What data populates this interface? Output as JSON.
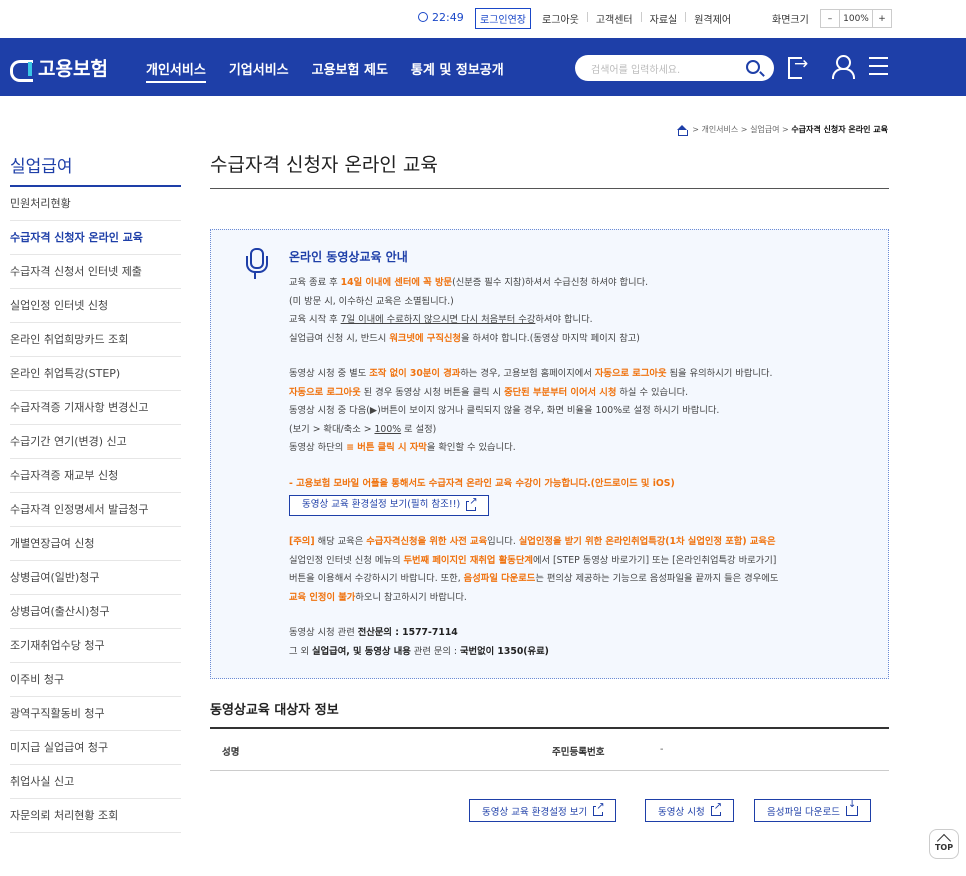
{
  "utility": {
    "time": "22:49",
    "extend_login": "로그인연장",
    "links": [
      "로그아웃",
      "고객센터",
      "자료실",
      "원격제어"
    ],
    "zoom_label": "화면크기",
    "zoom_minus": "–",
    "zoom_value": "100%",
    "zoom_plus": "+"
  },
  "header": {
    "logo": "고용보험",
    "menu": [
      "개인서비스",
      "기업서비스",
      "고용보험 제도",
      "통계 및 정보공개"
    ],
    "active_menu": "개인서비스",
    "search_placeholder": "검색어를 입력하세요."
  },
  "breadcrumb": {
    "items": [
      "개인서비스",
      "실업급여"
    ],
    "current": "수급자격 신청자 온라인 교육"
  },
  "sidebar": {
    "title": "실업급여",
    "items": [
      "민원처리현황",
      "수급자격 신청자 온라인 교육",
      "수급자격 신청서 인터넷 제출",
      "실업인정 인터넷 신청",
      "온라인 취업희망카드 조회",
      "온라인 취업특강(STEP)",
      "수급자격증 기재사항 변경신고",
      "수급기간 연기(변경) 신고",
      "수급자격증 재교부 신청",
      "수급자격 인정명세서 발급청구",
      "개별연장급여 신청",
      "상병급여(일반)청구",
      "상병급여(출산시)청구",
      "조기재취업수당 청구",
      "이주비 청구",
      "광역구직활동비 청구",
      "미지급 실업급여 청구",
      "취업사실 신고",
      "자문의뢰 처리현황 조회"
    ],
    "active_index": 1
  },
  "page": {
    "title": "수급자격 신청자 온라인 교육"
  },
  "guide": {
    "title": "온라인 동영상교육 안내",
    "p1": {
      "a1": "교육 종료 후 ",
      "a2": "14일 이내에 센터에 꼭 방문",
      "a3": "(신분증 필수 지참)하셔서 수급신청 하셔야 합니다.",
      "b": "(미 방문 시, 이수하신 교육은 소멸됩니다.)",
      "c1": "교육 시작 후 ",
      "c2": "7일 이내에 수료하지 않으시면 다시 처음부터 수강",
      "c3": "하셔야 합니다.",
      "d1": "실업급여 신청 시, 반드시 ",
      "d2": "워크넷에 구직신청",
      "d3": "을 하셔야 합니다.(동영상 마지막 페이지 참고)"
    },
    "p2": {
      "a1": "동영상 시청 중 별도 ",
      "a2": "조작 없이 30분이 경과",
      "a3": "하는 경우, 고용보험 홈페이지에서 ",
      "a4": "자동으로 로그아웃",
      "a5": " 됨을 유의하시기 바랍니다.",
      "b1": "자동으로 로그아웃",
      "b2": " 된 경우 동영상 시청 버튼을 클릭 시 ",
      "b3": "중단된 부분부터 이어서 시청",
      "b4": " 하실 수 있습니다.",
      "c": "동영상 시청 중 다음(▶)버튼이 보이지 않거나 클릭되지 않을 경우, 화면 비율을 100%로 설정 하시기 바랍니다.",
      "d1": "(보기 > 확대/축소 > ",
      "d2": "100%",
      "d3": " 로 설정)",
      "e1": "동영상 하단의 ",
      "e2": "≡ 버튼 클릭 시 자막",
      "e3": "을 확인할 수 있습니다."
    },
    "mobile_notice": "- 고용보험 모바일 어플을 통해서도 수급자격 온라인 교육 수강이 가능합니다.(안드로이드 및 iOS)",
    "env_button": "동영상 교육 환경설정 보기(필히 참조!!)",
    "p3": {
      "a1": "[주의]",
      "a2": " 해당 교육은 ",
      "a3": "수급자격신청을 위한 사전 교육",
      "a4": "입니다. ",
      "a5": "실업인정을 받기 위한 온라인취업특강(1차 실업인정 포함) 교육은",
      "b1": "실업인정 인터넷 신청 메뉴의 ",
      "b2": "두번째 페이지인 재취업 활동단계",
      "b3": "에서 [STEP 동영상 바로가기] 또는 [온라인취업특강 바로가기]",
      "c1": "버튼을 이용해서 수강하시기 바랍니다. 또한, ",
      "c2": "음성파일 다운로드",
      "c3": "는 편의상 제공하는 기능으로 음성파일을 끝까지 들은 경우에도",
      "d1": "교육 인정이 불가",
      "d2": "하오니 참고하시기 바랍니다."
    },
    "p4": {
      "a1": "동영상 시청 관련 ",
      "a2": "전산문의 : 1577-7114",
      "b1": "그 외 ",
      "b2": "실업급여, 및 동영상 내용",
      "b3": " 관련 문의 : ",
      "b4": "국번없이 1350(유료)"
    }
  },
  "target_info": {
    "title": "동영상교육 대상자 정보",
    "name_label": "성명",
    "name_value": "",
    "rrn_label": "주민등록번호",
    "rrn_value": "-"
  },
  "buttons": {
    "env": "동영상 교육 환경설정 보기",
    "watch": "동영상 시청",
    "download": "음성파일 다운로드"
  },
  "top_button": "TOP",
  "colors": {
    "brand_blue": "#1e3fa8",
    "accent_orange": "#f0730f",
    "guide_bg": "#f4f8fe"
  }
}
